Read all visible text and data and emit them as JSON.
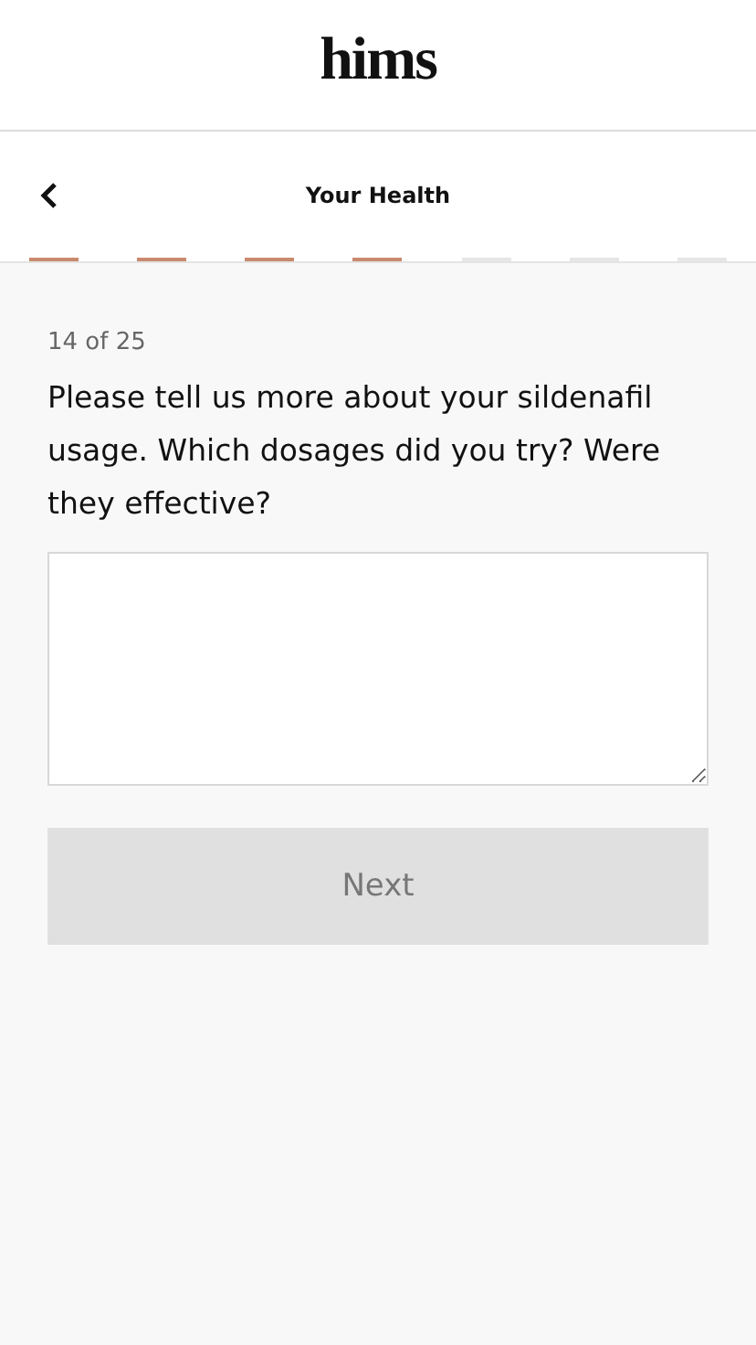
{
  "logo": "hims",
  "nav": {
    "title": "Your Health"
  },
  "progress": [
    {
      "done": true
    },
    {
      "done": true
    },
    {
      "done": true
    },
    {
      "done": true
    },
    {
      "done": false
    },
    {
      "done": false
    },
    {
      "done": false
    }
  ],
  "step": "14 of 25",
  "question": "Please tell us more about your sildenafil usage. Which dosages did you try? Were they effective?",
  "next_button": {
    "label": "Next",
    "disabled": true
  }
}
